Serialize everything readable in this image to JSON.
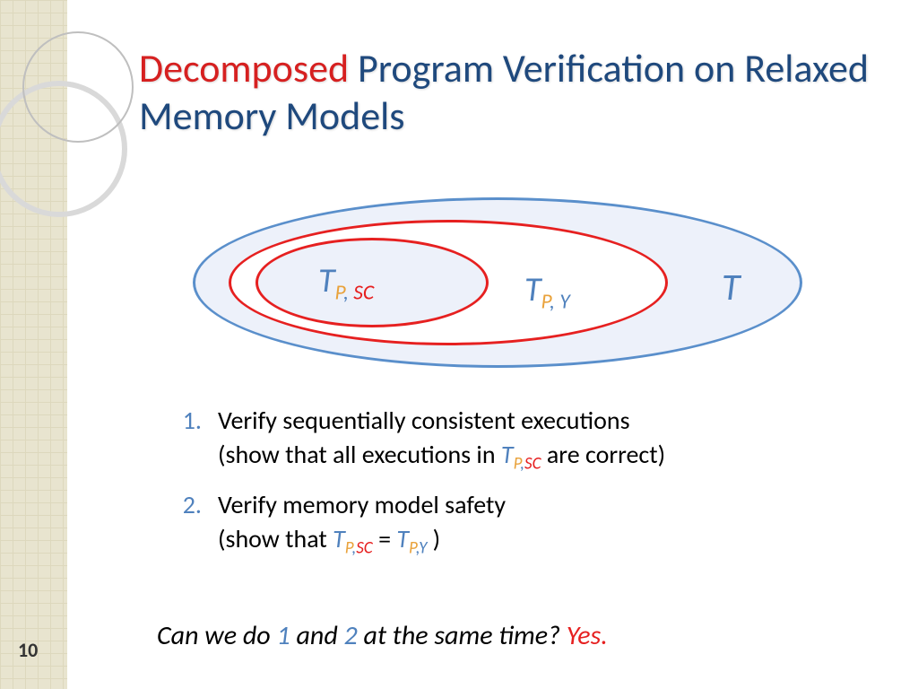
{
  "page_number": "10",
  "title": {
    "part1": "Decomposed",
    "part2": " Program Verification on Relaxed Memory Models"
  },
  "diagram": {
    "inner_T": "T",
    "inner_P": "P",
    "inner_sep": ", ",
    "inner_SC": "SC",
    "mid_T": "T",
    "mid_P": "P",
    "mid_sep": ", ",
    "mid_Y": "Y",
    "outer_T": "T"
  },
  "list": {
    "item1": {
      "num": "1.",
      "line1": "Verify sequentially consistent executions",
      "line2a": "(show that all executions in ",
      "t_T": "T",
      "t_P": "P",
      "t_sep": ",",
      "t_SC": "SC",
      "line2b": " are correct)"
    },
    "item2": {
      "num": "2.",
      "line1": "Verify memory model safety",
      "line2a": "(show that ",
      "t1_T": "T",
      "t1_P": "P",
      "t1_sep": ",",
      "t1_SC": "SC",
      "eq": " = ",
      "t2_T": "T",
      "t2_P": "P",
      "t2_sep": ",",
      "t2_Y": "Y",
      "line2b": " )"
    }
  },
  "question": {
    "a": "Can we do ",
    "n1": "1",
    "b": " and ",
    "n2": "2",
    "c": " at the same time?   ",
    "ans": "Yes."
  }
}
